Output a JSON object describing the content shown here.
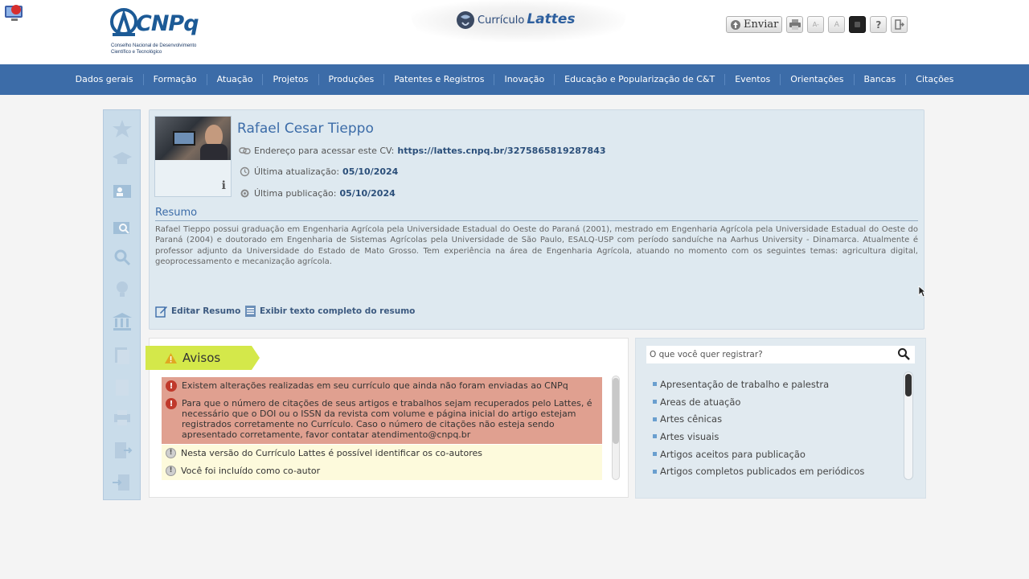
{
  "header": {
    "logo_text": "CNPq",
    "logo_subtitle": "Conselho Nacional de Desenvolvimento Científico e Tecnológico",
    "app_title_prefix": "Currículo",
    "app_title_name": "Lattes",
    "send_label": "Enviar",
    "toolbar_icons": [
      "print-icon",
      "font-decrease-icon",
      "font-increase-icon",
      "high-contrast-icon",
      "help-icon",
      "logout-icon"
    ]
  },
  "nav": {
    "items": [
      "Dados gerais",
      "Formação",
      "Atuação",
      "Projetos",
      "Produções",
      "Patentes e Registros",
      "Inovação",
      "Educação e Popularização de C&T",
      "Eventos",
      "Orientações",
      "Bancas",
      "Citações"
    ]
  },
  "profile": {
    "name": "Rafael Cesar Tieppo",
    "cv_label": "Endereço para acessar este CV:",
    "cv_url": "https://lattes.cnpq.br/3275865819287843",
    "updated_label": "Última atualização:",
    "updated_date": "05/10/2024",
    "published_label": "Última publicação:",
    "published_date": "05/10/2024",
    "resumo_title": "Resumo",
    "resumo_text": "Rafael Tieppo possui graduação em Engenharia Agrícola pela Universidade Estadual do Oeste do Paraná (2001), mestrado em Engenharia Agrícola pela Universidade Estadual do Oeste do Paraná (2004) e doutorado em Engenharia de Sistemas Agrícolas pela Universidade de São Paulo, ESALQ-USP com período sanduíche na Aarhus University - Dinamarca. Atualmente é professor adjunto da Universidade do Estado de Mato Grosso. Tem experiência na área de Engenharia Agrícola, atuando no momento com os seguintes temas: agricultura digital, geoprocessamento e mecanização agrícola.",
    "edit_resumo": "Editar Resumo",
    "full_resumo": "Exibir texto completo do resumo"
  },
  "avisos": {
    "title": "Avisos",
    "errors": [
      "Existem alterações realizadas em seu currículo que ainda não foram enviadas ao CNPq",
      "Para que o número de citações de seus artigos e trabalhos sejam recuperados pelo Lattes, é necessário que o DOI ou o ISSN da revista com volume e página inicial do artigo estejam registrados corretamente no Currículo. Caso o número de citações não esteja sendo apresentado corretamente, favor contatar atendimento@cnpq.br"
    ],
    "notes": [
      "Nesta versão do Currículo Lattes é possível identificar os co-autores",
      "Você foi incluído como co-autor"
    ]
  },
  "registrar": {
    "placeholder": "O que você quer registrar?",
    "items": [
      "Apresentação de trabalho e palestra",
      "Areas de atuação",
      "Artes cênicas",
      "Artes visuais",
      "Artigos aceitos para publicação",
      "Artigos completos publicados em periódicos"
    ]
  },
  "colors": {
    "nav_bg": "#3c6ca8",
    "panel_bg": "#dee9f0",
    "avisos_tab": "#d4e84a",
    "alert_red": "#e0a090",
    "alert_yellow": "#fdfadc"
  }
}
